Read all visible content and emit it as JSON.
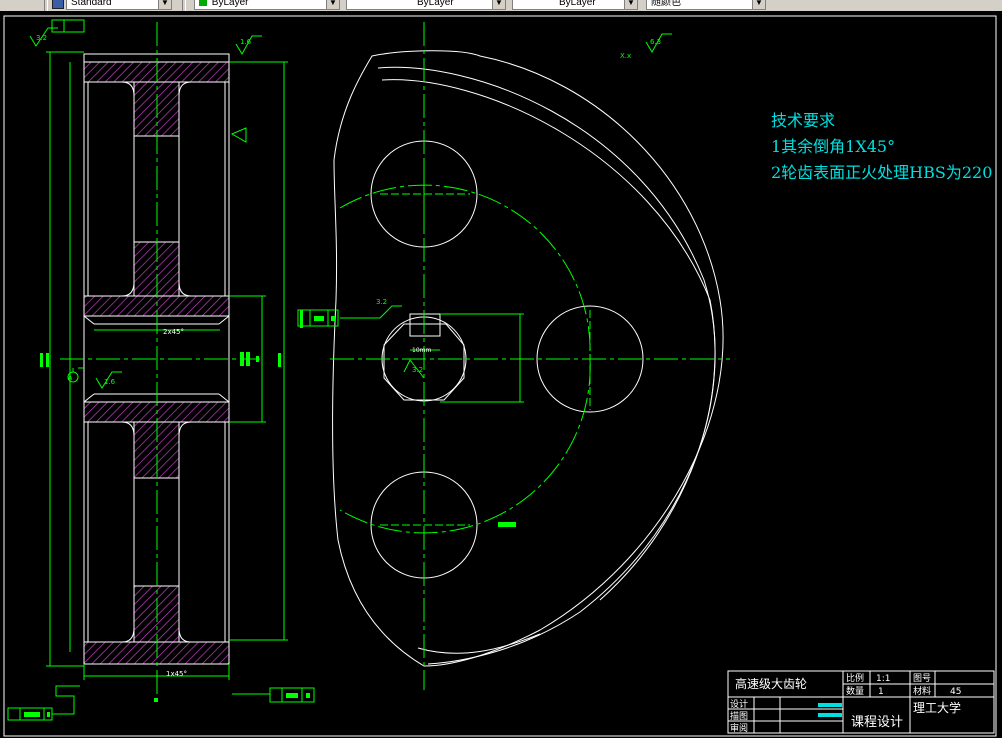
{
  "toolbar": {
    "text_style": "Standard",
    "layer": "ByLayer",
    "linetype": "ByLayer",
    "lineweight": "ByLayer",
    "plot_style": "随颜色"
  },
  "drawing": {
    "tech_title": "技术要求",
    "tech_line1": "1其余倒角1X45°",
    "tech_line2": "2轮齿表面正火处理HBS为220",
    "rough_32": "3.2",
    "rough_16": "1.6",
    "rough_125": "12.5",
    "rough_63": "6.3",
    "datum_a": "A",
    "dim_bore": "2x45°",
    "dim_width": "1x45°",
    "dim_key": "10mm",
    "symbol_x": "X.x"
  },
  "title_block": {
    "part_name": "高速级大齿轮",
    "scale_label": "比例",
    "scale_value": "1:1",
    "drawing_no_label": "图号",
    "quantity_label": "数量",
    "quantity_value": "1",
    "material_label": "材料",
    "material_value": "45",
    "design_label": "设计",
    "draw_label": "描图",
    "review_label": "审阅",
    "course": "课程设计",
    "school": "理工大学"
  },
  "colors": {
    "line_white": "#ffffff",
    "line_green": "#00ff00",
    "hatch_magenta": "#c040c0",
    "text_cyan": "#00e0e0"
  }
}
